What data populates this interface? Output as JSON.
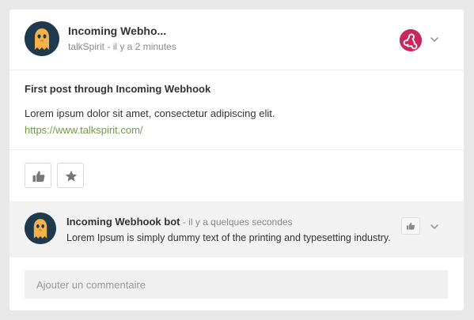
{
  "post": {
    "author": "Incoming Webho...",
    "source": "talkSpirit",
    "separator": " - ",
    "time": "il y a 2 minutes",
    "app_icon": "webhook-icon",
    "title": "First post through Incoming Webhook",
    "text": "Lorem ipsum dolor sit amet, consectetur adipiscing elit.",
    "link": "https://www.talkspirit.com/",
    "link_color": "#6f9a48",
    "app_icon_color": "#c8285b"
  },
  "actions": {
    "like_icon": "thumbs-up-icon",
    "favorite_icon": "star-icon"
  },
  "comment": {
    "author": "Incoming Webhook bot",
    "time": " - il y a quelques secondes",
    "text": "Lorem Ipsum is simply dummy text of the printing and typesetting industry.",
    "like_icon": "thumbs-up-icon"
  },
  "comment_box": {
    "placeholder": "Ajouter un commentaire"
  },
  "colors": {
    "avatar_bg": "#1f3a4d",
    "avatar_ghost": "#f6b24a",
    "page_bg": "#e8e8e8",
    "comment_bg": "#f2f2f2"
  }
}
